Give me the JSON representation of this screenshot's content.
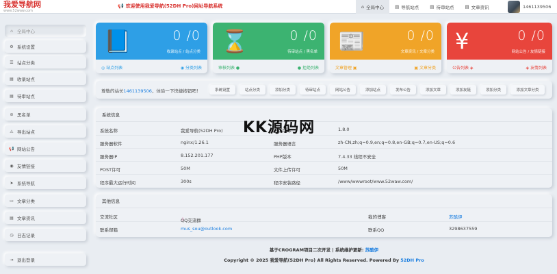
{
  "logo": {
    "title": "我爱导航网",
    "url": "www.52waw.com"
  },
  "welcome": "欢迎使用我爱导航(52DH Pro)网址导航系统",
  "topnav": [
    {
      "label": "全局中心",
      "icon": "home-icon",
      "active": true
    },
    {
      "label": "导航站点",
      "icon": "doc-icon",
      "active": false
    },
    {
      "label": "待审站点",
      "icon": "doc-icon",
      "active": false
    },
    {
      "label": "文章资讯",
      "icon": "doc-icon",
      "active": false
    }
  ],
  "user": {
    "name": "1461139506"
  },
  "sidebar": [
    {
      "label": "全局中心",
      "icon": "home-icon"
    },
    {
      "label": "系统设置",
      "icon": "gear-icon"
    },
    {
      "label": "站点分类",
      "icon": "list-icon"
    },
    {
      "label": "收录站点",
      "icon": "doc-icon"
    },
    {
      "label": "待审站点",
      "icon": "doc-icon"
    },
    {
      "label": "黑名单",
      "icon": "block-icon"
    },
    {
      "label": "导出站点",
      "icon": "warning-icon"
    },
    {
      "label": "网站公告",
      "icon": "megaphone-icon"
    },
    {
      "label": "友情链接",
      "icon": "eye-icon"
    },
    {
      "label": "系统导航",
      "icon": "nav-icon"
    },
    {
      "label": "文章分类",
      "icon": "folder-icon"
    },
    {
      "label": "文章资讯",
      "icon": "doc-icon"
    },
    {
      "label": "日志记录",
      "icon": "clock-icon"
    },
    {
      "label": "退出登录",
      "icon": "logout-icon"
    }
  ],
  "cards": [
    {
      "icon": "book-icon",
      "value": "0 /0",
      "label": "收录站点 / 站点分类",
      "left_link": "站点列表",
      "right_link": "分类列表",
      "color": "#2e9fe6"
    },
    {
      "icon": "hourglass-icon",
      "value": "0 /0",
      "label": "待审站点 / 黑名单",
      "left_link": "审核列表",
      "right_link": "拒绝列表",
      "color": "#3cb371"
    },
    {
      "icon": "newspaper-icon",
      "value": "0 /0",
      "label": "文章资讯 / 文章分类",
      "left_link": "文章管理",
      "right_link": "文章分类",
      "color": "#f0a428"
    },
    {
      "icon": "yen-icon",
      "value": "0 /0",
      "label": "网站公告 / 友情链接",
      "left_link": "公告列表",
      "right_link": "友情列表",
      "color": "#e8453c"
    }
  ],
  "quickbar": {
    "text_before": "尊敬的站长",
    "qq": "1461139506",
    "text_after": "，体验一下快捷按钮吧！",
    "buttons": [
      "系统设置",
      "站点分类",
      "添加分类",
      "待审站点",
      "网站公告",
      "添加站点",
      "发布公告",
      "添加文章",
      "添加友链",
      "添加分类",
      "添加文章分类"
    ]
  },
  "sysinfo": {
    "title": "系统信息",
    "rows": [
      {
        "k1": "系统名称",
        "v1": "我爱导航(52DH Pro)",
        "k2": "当前版本",
        "v2": "1.8.0"
      },
      {
        "k1": "服务器软件",
        "v1": "nginx/1.26.1",
        "k2": "服务器语言",
        "v2": "zh-CN,zh;q=0.9,en;q=0.8,en-GB;q=0.7,en-US;q=0.6"
      },
      {
        "k1": "服务器IP",
        "v1": "8.152.201.177",
        "k2": "PHP版本",
        "v2": "7.4.33 线程不安全"
      },
      {
        "k1": "POST许可",
        "v1": "50M",
        "k2": "文件上传许可",
        "v2": "50M"
      },
      {
        "k1": "程序最大运行时间",
        "v1": "300s",
        "k2": "程序安装路径",
        "v2": "/www/wwwroot/www.52waw.com/"
      }
    ]
  },
  "other": {
    "title": "其他信息",
    "rows": [
      {
        "k1": "交流社区",
        "v1": "QQ交流群",
        "k2": "我的博客",
        "v2": "苏酷伊"
      },
      {
        "k1": "联系邮箱",
        "v1": "mus_sou@outlook.com",
        "k2": "联系QQ",
        "v2": "3298637559"
      }
    ]
  },
  "watermark": "KK源码网",
  "footer": {
    "line1_prefix": "基于CROGRAM项目二次开发 | 系统维护更新:",
    "line1_link": "苏酷伊",
    "line2_prefix": "Copyright © 2025 我爱导航(52DH Pro) All Rights Reserved. Powered By",
    "line2_link": "52DH Pro"
  },
  "colors": {
    "brand_red": "#d8322f",
    "blue": "#2e9fe6",
    "green": "#3cb371",
    "orange": "#f0a428",
    "red": "#e8453c",
    "link": "#1a7ee0"
  }
}
